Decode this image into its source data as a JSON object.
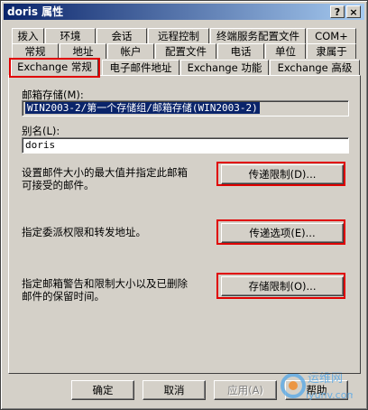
{
  "window": {
    "title": "doris 属性",
    "help_btn": "?",
    "close_btn": "×"
  },
  "tabs": {
    "row1": [
      "拨入",
      "环境",
      "会话",
      "远程控制",
      "终端服务配置文件",
      "COM+"
    ],
    "row2": [
      "常规",
      "地址",
      "帐户",
      "配置文件",
      "电话",
      "单位",
      "隶属于"
    ],
    "row3": [
      "Exchange 常规",
      "电子邮件地址",
      "Exchange 功能",
      "Exchange 高级"
    ]
  },
  "mailbox_store": {
    "label": "邮箱存储(M):",
    "value": "WIN2003-2/第一个存储组/邮箱存储(WIN2003-2)"
  },
  "alias": {
    "label": "别名(L):",
    "value": "doris"
  },
  "sections": {
    "delivery_restrictions_desc_1": "设置邮件大小的最大值并指定此邮箱",
    "delivery_restrictions_desc_2": "可接受的邮件。",
    "delivery_restrictions_button": "传递限制(D)...",
    "delivery_options_desc": "指定委派权限和转发地址。",
    "delivery_options_button": "传递选项(E)...",
    "storage_limits_desc_1": "指定邮箱警告和限制大小以及已删除",
    "storage_limits_desc_2": "邮件的保留时间。",
    "storage_limits_button": "存储限制(O)..."
  },
  "footer": {
    "ok": "确定",
    "cancel": "取消",
    "apply": "应用(A)",
    "help": "帮助"
  },
  "watermark": {
    "text_cn": "运维网",
    "text_domain": "iyunv.com"
  },
  "colors": {
    "highlight_red": "#e00000",
    "title_start": "#0a246a",
    "face": "#d4d0c8"
  }
}
